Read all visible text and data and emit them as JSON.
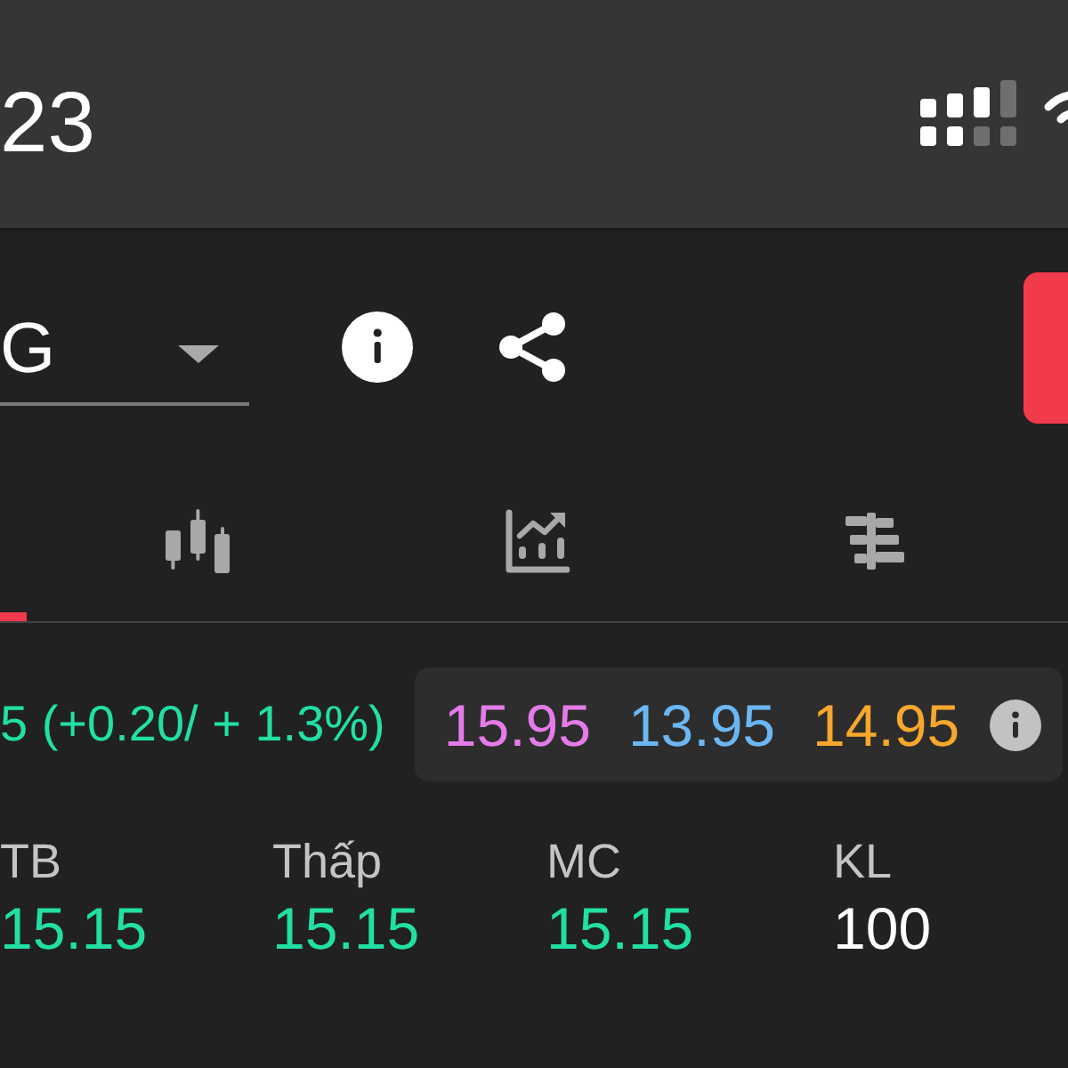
{
  "status_bar": {
    "time": "23"
  },
  "toolbar": {
    "symbol_select": {
      "value": "G"
    }
  },
  "tabs": [
    {
      "selected": true
    },
    {
      "kind": "candlestick",
      "selected": false
    },
    {
      "kind": "chart",
      "selected": false
    },
    {
      "kind": "depth",
      "selected": false
    }
  ],
  "quote": {
    "change": "5 (+0.20/ + 1.3%)",
    "reference_prices": [
      {
        "value": "15.95",
        "color": "#e57be9"
      },
      {
        "value": "13.95",
        "color": "#6cb7f2"
      },
      {
        "value": "14.95",
        "color": "#f7a72b"
      }
    ]
  },
  "stats": [
    {
      "label": "TB",
      "value": "15.15",
      "color": "#22dfa4"
    },
    {
      "label": "Thấp",
      "value": "15.15",
      "color": "#22dfa4"
    },
    {
      "label": "MC",
      "value": "15.15",
      "color": "#22dfa4"
    },
    {
      "label": "KL",
      "value": "100",
      "color": "#ffffff"
    }
  ]
}
